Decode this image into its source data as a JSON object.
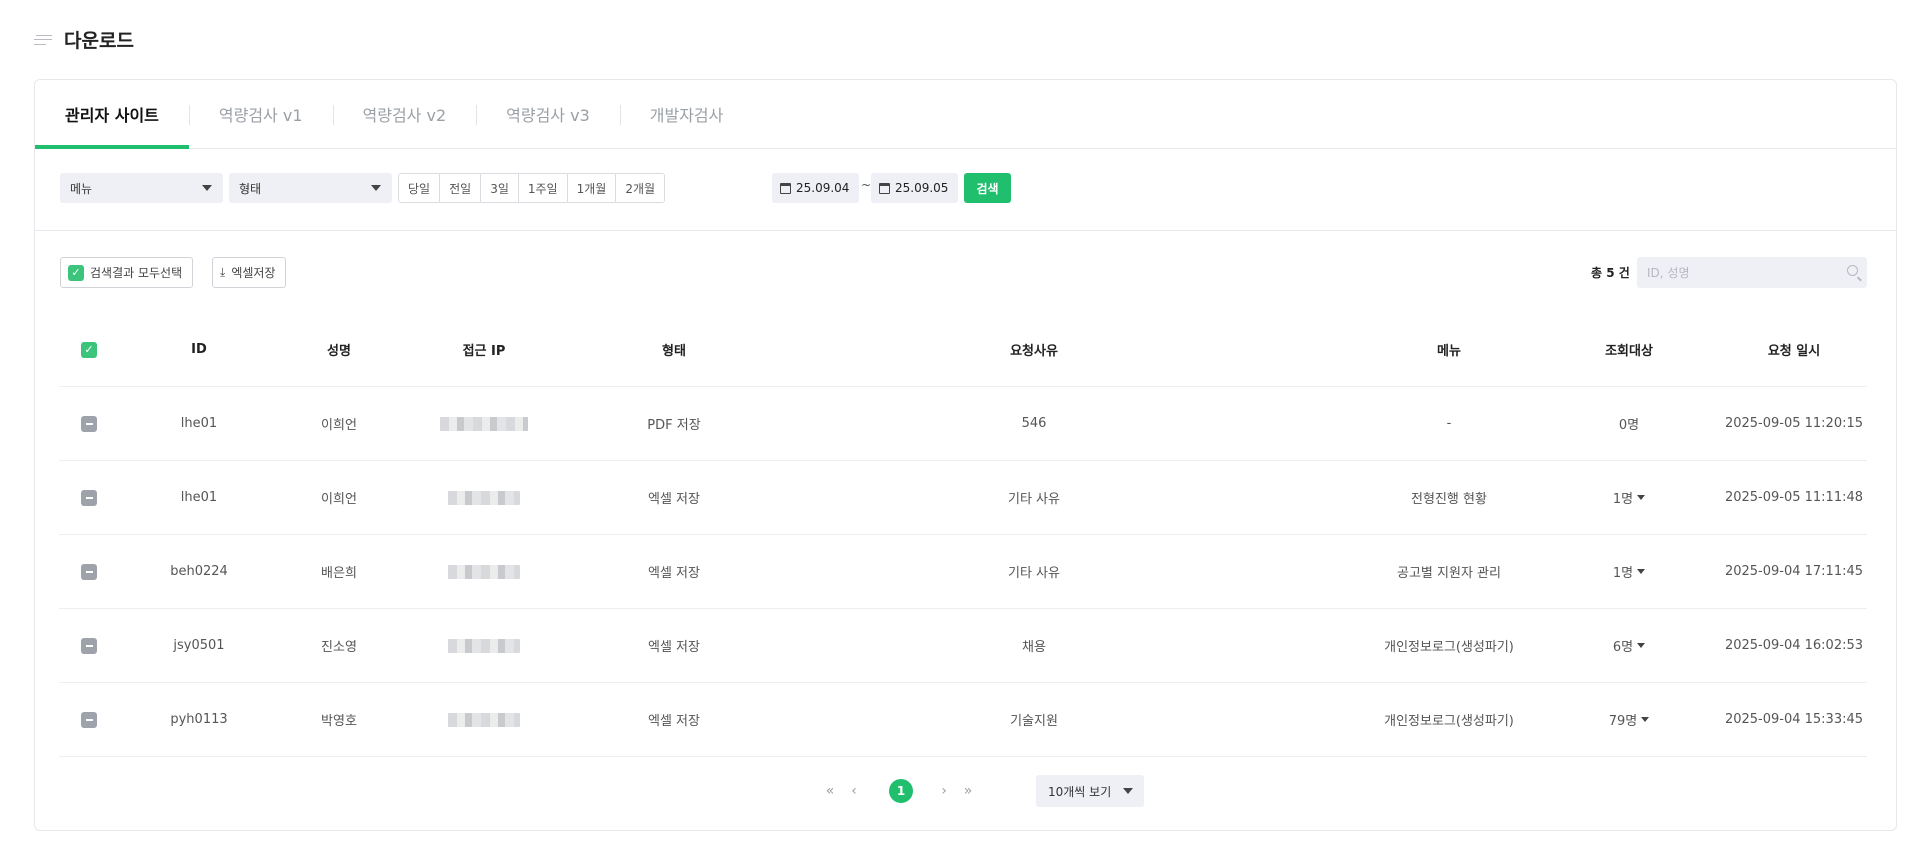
{
  "page": {
    "title": "다운로드"
  },
  "tabs": [
    {
      "label": "관리자 사이트",
      "active": true
    },
    {
      "label": "역량검사 v1",
      "active": false
    },
    {
      "label": "역량검사 v2",
      "active": false
    },
    {
      "label": "역량검사 v3",
      "active": false
    },
    {
      "label": "개발자검사",
      "active": false
    }
  ],
  "filters": {
    "menu_select": "메뉴",
    "type_select": "형태",
    "periods": [
      "당일",
      "전일",
      "3일",
      "1주일",
      "1개월",
      "2개월"
    ],
    "date_from": "25.09.04",
    "tilde": "~",
    "date_to": "25.09.05",
    "search_label": "검색"
  },
  "actions": {
    "select_all_label": "검색결과 모두선택",
    "excel_label": "엑셀저장",
    "total_label": "총 5 건",
    "search_placeholder": "ID, 성명"
  },
  "table": {
    "headers": {
      "id": "ID",
      "name": "성명",
      "ip": "접근 IP",
      "type": "형태",
      "reason": "요청사유",
      "menu": "메뉴",
      "target": "조회대상",
      "date": "요청 일시"
    },
    "rows": [
      {
        "id": "lhe01",
        "name": "이희언",
        "type": "PDF 저장",
        "reason": "546",
        "menu": "-",
        "target": "0명",
        "target_dropdown": false,
        "date": "2025-09-05 11:20:15"
      },
      {
        "id": "lhe01",
        "name": "이희언",
        "type": "엑셀 저장",
        "reason": "기타 사유",
        "menu": "전형진행 현황",
        "target": "1명",
        "target_dropdown": true,
        "date": "2025-09-05 11:11:48"
      },
      {
        "id": "beh0224",
        "name": "배은희",
        "type": "엑셀 저장",
        "reason": "기타 사유",
        "menu": "공고별 지원자 관리",
        "target": "1명",
        "target_dropdown": true,
        "date": "2025-09-04 17:11:45"
      },
      {
        "id": "jsy0501",
        "name": "진소영",
        "type": "엑셀 저장",
        "reason": "채용",
        "menu": "개인정보로그(생성파기)",
        "target": "6명",
        "target_dropdown": true,
        "date": "2025-09-04 16:02:53"
      },
      {
        "id": "pyh0113",
        "name": "박영호",
        "type": "엑셀 저장",
        "reason": "기술지원",
        "menu": "개인정보로그(생성파기)",
        "target": "79명",
        "target_dropdown": true,
        "date": "2025-09-04 15:33:45"
      }
    ]
  },
  "pagination": {
    "current_page": "1",
    "page_size_label": "10개씩 보기"
  },
  "colors": {
    "accent": "#1fbf6e",
    "checkbox_checked": "#3cc47c",
    "checkbox_indeterminate": "#9ea3ab",
    "field_bg": "#eef0f5"
  }
}
